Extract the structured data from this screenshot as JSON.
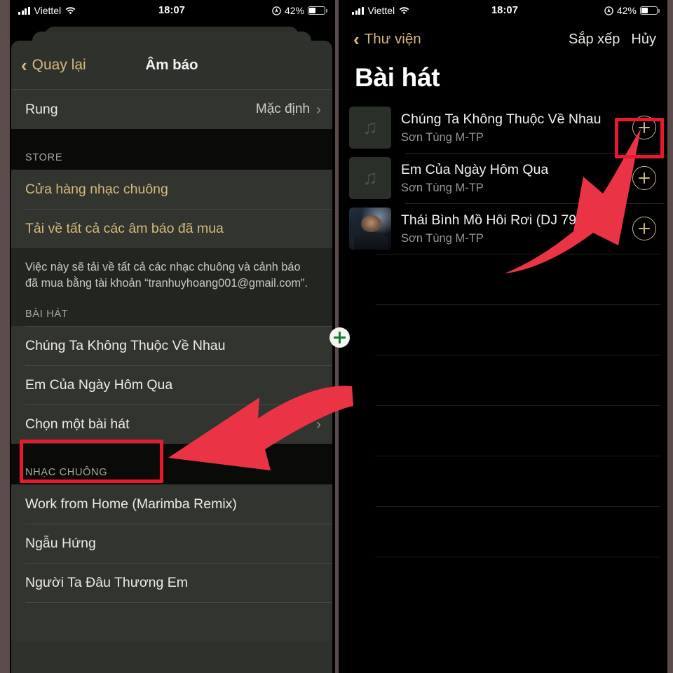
{
  "status_bar": {
    "carrier": "Viettel",
    "time": "18:07",
    "battery_percent": "42%"
  },
  "left_panel": {
    "nav": {
      "back_label": "Quay lại",
      "title": "Âm báo"
    },
    "vibration_row": {
      "label": "Rung",
      "value": "Mặc định"
    },
    "store_section": {
      "header": "STORE",
      "items": [
        "Cửa hàng nhạc chuông",
        "Tải về tất cả các âm báo đã mua"
      ],
      "footnote": "Việc này sẽ tải về tất cả các nhạc chuông và cảnh báo đã mua bằng tài khoản “tranhuyhoang001@gmail.com”."
    },
    "songs_section": {
      "header": "BÀI HÁT",
      "items": [
        "Chúng Ta Không Thuộc Về Nhau",
        "Em Của Ngày Hôm Qua"
      ],
      "choose_row": "Chọn một bài hát"
    },
    "ringtones_section": {
      "header": "NHẠC CHUÔNG",
      "items": [
        "Work from Home (Marimba Remix)",
        "Ngẫu Hứng",
        "Người Ta Đâu Thương Em"
      ]
    }
  },
  "right_panel": {
    "nav": {
      "back_label": "Thư viện",
      "sort_label": "Sắp xếp",
      "cancel_label": "Hủy"
    },
    "title": "Bài hát",
    "songs": [
      {
        "title": "Chúng Ta Không Thuộc Về Nhau",
        "artist": "Sơn Tùng M-TP",
        "artwork": "music-note-placeholder"
      },
      {
        "title": "Em Của Ngày Hôm Qua",
        "artist": "Sơn Tùng M-TP",
        "artwork": "music-note-placeholder"
      },
      {
        "title": "Thái Bình Mồ Hôi Rơi (DJ 79 Remo...",
        "artist": "Sơn Tùng M-TP",
        "artwork": "album-photo"
      }
    ],
    "add_icon": "plus-circle-icon"
  },
  "annotations": {
    "highlight_color": "#e8192c",
    "arrow_color": "#ea3446",
    "badge_plus_color": "#1d7a2e"
  }
}
